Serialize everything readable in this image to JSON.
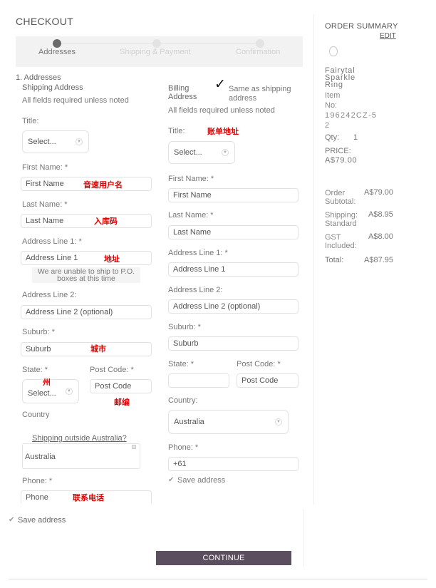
{
  "header": {
    "title": "CHECKOUT"
  },
  "steps": [
    {
      "label": "Addresses"
    },
    {
      "label": "Shipping & Payment"
    },
    {
      "label": "Confirmation"
    }
  ],
  "section": {
    "title": "1. Addresses"
  },
  "shipping": {
    "heading": "Shipping Address",
    "note": "All fields required unless noted",
    "title_label": "Title:",
    "title_value": "Select...",
    "first_name_label": "First Name: *",
    "first_name_placeholder": "First Name",
    "last_name_label": "Last Name: *",
    "last_name_placeholder": "Last Name",
    "address1_label": "Address Line 1: *",
    "address1_placeholder": "Address Line 1",
    "po_box_warning": "We are unable to ship to P.O. boxes at this time",
    "address2_label": "Address Line 2:",
    "address2_placeholder": "Address Line 2 (optional)",
    "suburb_label": "Suburb: *",
    "suburb_placeholder": "Suburb",
    "state_label": "State: *",
    "state_value": "Select...",
    "postcode_label": "Post Code: *",
    "postcode_placeholder": "Post Code",
    "country_label": "Country",
    "outside_link": "Shipping outside Australia?",
    "country_value": "Australia",
    "phone_label": "Phone: *",
    "phone_placeholder": "Phone"
  },
  "billing": {
    "heading": "Billing Address",
    "same_as_label": "Same as shipping address",
    "same_as_checked": true,
    "note": "All fields required unless noted",
    "title_label": "Title:",
    "title_value": "Select...",
    "first_name_label": "First Name: *",
    "first_name_placeholder": "First Name",
    "last_name_label": "Last Name: *",
    "last_name_placeholder": "Last Name",
    "address1_label": "Address Line 1: *",
    "address1_placeholder": "Address Line 1",
    "address2_label": "Address Line 2:",
    "address2_placeholder": "Address Line 2 (optional)",
    "suburb_label": "Suburb: *",
    "suburb_placeholder": "Suburb",
    "state_label": "State: *",
    "postcode_label": "Post Code: *",
    "postcode_placeholder": "Post Code",
    "country_label": "Country:",
    "country_value": "Australia",
    "phone_label": "Phone: *",
    "phone_value": "+61",
    "save_label": "Save address",
    "save_checked": true
  },
  "annotations": {
    "billing_address": "账单地址",
    "first_name": "音速用户名",
    "last_name": "入库码",
    "address": "地址",
    "city": "城市",
    "state": "州",
    "postcode": "邮编",
    "phone": "联系电话"
  },
  "bottom": {
    "save_label": "Save address",
    "continue_label": "CONTINUE"
  },
  "summary": {
    "title": "ORDER SUMMARY",
    "edit_label": "EDIT",
    "item_name": "Fairytal Sparkle Ring",
    "item_no_label": "Item No:",
    "item_no_value": "196242CZ-52",
    "qty_label": "Qty:",
    "qty_value": "1",
    "price_label": "PRICE:",
    "price_value": "A$79.00",
    "subtotal_label": "Order Subtotal:",
    "subtotal_value": "A$79.00",
    "shipping_label": "Shipping: Standard",
    "shipping_value": "A$8.95",
    "gst_label": "GST Included:",
    "gst_value": "A$8.00",
    "total_label": "Total:",
    "total_value": "A$87.95"
  },
  "colors": {
    "continue_bg": "#5b4e5f",
    "annotation_red": "#e00000",
    "stepper_bg": "#f2f2f2"
  }
}
